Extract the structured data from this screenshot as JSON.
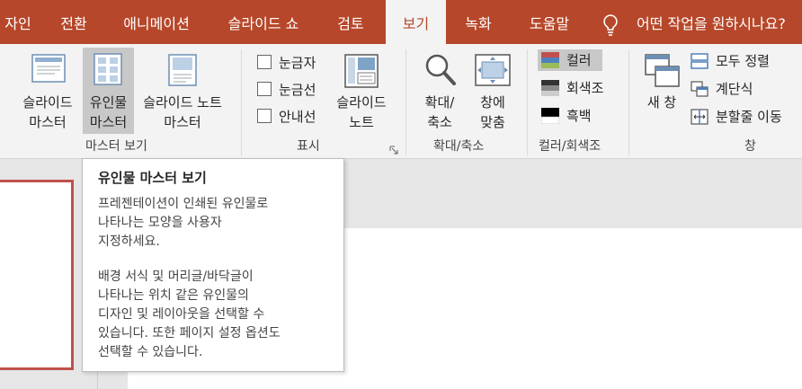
{
  "tabs": [
    {
      "label": "자인"
    },
    {
      "label": "전환"
    },
    {
      "label": "애니메이션"
    },
    {
      "label": "슬라이드 쇼"
    },
    {
      "label": "검토"
    },
    {
      "label": "보기"
    },
    {
      "label": "녹화"
    },
    {
      "label": "도움말"
    }
  ],
  "tell_me": "어떤 작업을 원하시나요?",
  "groups": {
    "master_views": {
      "label": "마스터 보기",
      "slide_master": "슬라이드\n마스터",
      "handout_master": "유인물\n마스터",
      "notes_master": "슬라이드 노트\n마스터"
    },
    "show": {
      "label": "표시",
      "ruler": "눈금자",
      "gridlines": "눈금선",
      "guides": "안내선",
      "notes": "슬라이드\n노트"
    },
    "zoom": {
      "label": "확대/축소",
      "zoom": "확대/\n축소",
      "fit_to_window": "창에\n맞춤"
    },
    "color": {
      "label": "컬러/회색조",
      "color": "컬러",
      "grayscale": "회색조",
      "black_white": "흑백"
    },
    "window": {
      "label": "창",
      "new_window": "새 창",
      "arrange_all": "모두 정렬",
      "cascade": "계단식",
      "move_split": "분할줄 이동"
    }
  },
  "tooltip": {
    "title": "유인물 마스터 보기",
    "para1": "프레젠테이션이 인쇄된 유인물로\n나타나는 모양을 사용자\n지정하세요.",
    "para2": "배경 서식 및 머리글/바닥글이\n나타나는 위치 같은 유인물의\n디자인 및 레이아웃을 선택할 수\n있습니다. 또한 페이지 설정 옵션도\n선택할 수 있습니다."
  },
  "colors": {
    "accent": "#b7472a",
    "ribbon": "#f3f3f3",
    "thumbnail_border": "#c0504d"
  }
}
